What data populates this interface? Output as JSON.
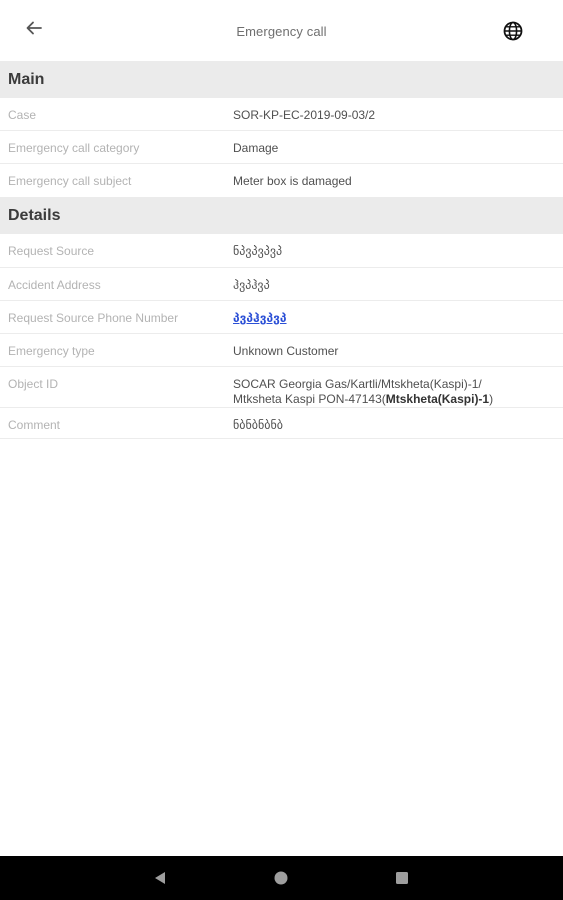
{
  "header": {
    "title": "Emergency call",
    "back_icon": "arrow-left-icon",
    "language_icon": "globe-icon"
  },
  "sections": {
    "main_title": "Main",
    "details_title": "Details"
  },
  "main": {
    "case_label": "Case",
    "case_value": "SOR-KP-EC-2019-09-03/2",
    "category_label": "Emergency call category",
    "category_value": "Damage",
    "subject_label": "Emergency call subject",
    "subject_value": "Meter box is damaged"
  },
  "details": {
    "request_source_label": "Request Source",
    "request_source_value": "ნპვპვპვპ",
    "accident_address_label": "Accident Address",
    "accident_address_value": "ჰვპჰვპ",
    "phone_label": "Request Source Phone Number",
    "phone_value": "პვპჰვპვპ",
    "emergency_type_label": "Emergency type",
    "emergency_type_value": "Unknown Customer",
    "object_id_label": "Object ID",
    "object_id_value_line1": "SOCAR Georgia Gas/Kartli/Mtskheta(Kaspi)-1/",
    "object_id_value_line2_prefix": "Mtksheta Kaspi PON-47143(",
    "object_id_value_line2_bold": "Mtskheta(Kaspi)-1",
    "object_id_value_line2_suffix": ")",
    "comment_label": "Comment",
    "comment_value": "ნბნბნბნბ"
  },
  "system_nav": {
    "back_icon": "triangle-back-icon",
    "home_icon": "circle-home-icon",
    "recents_icon": "square-recents-icon"
  },
  "colors": {
    "section_background": "#ebebeb",
    "link": "#2b4fd6",
    "nav_bar": "#000000"
  }
}
